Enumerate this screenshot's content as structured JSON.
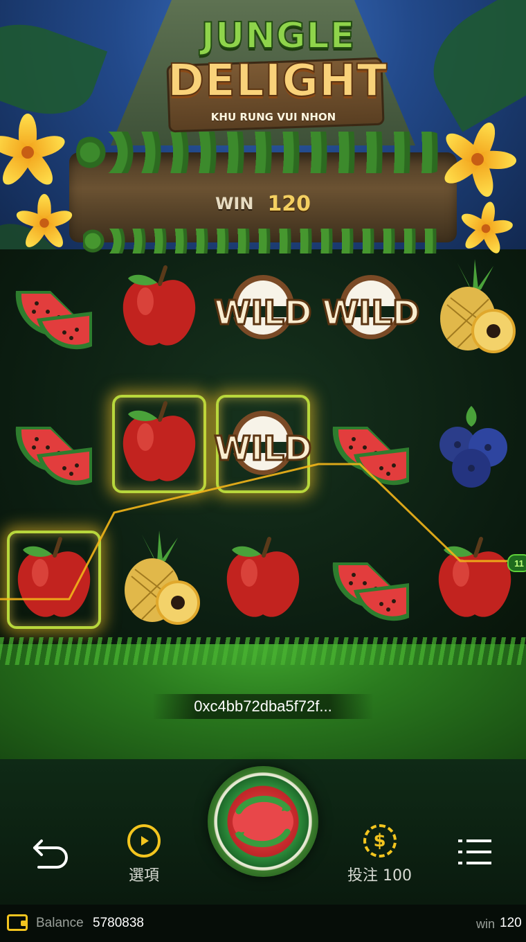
{
  "game": {
    "logo_line1": "JUNGLE",
    "logo_line2": "DELIGHT",
    "logo_subtitle": "KHU RUNG VUI NHON"
  },
  "win_banner": {
    "label": "WIN",
    "value": "120"
  },
  "reels": {
    "rows": [
      [
        "watermelon",
        "apple",
        "wild",
        "wild",
        "pineapple"
      ],
      [
        "watermelon",
        "apple",
        "wild",
        "watermelon",
        "blueberry"
      ],
      [
        "apple",
        "pineapple",
        "apple",
        "watermelon",
        "apple"
      ]
    ],
    "wild_label": "WILD",
    "highlighted": [
      [
        2,
        0
      ],
      [
        1,
        1
      ],
      [
        1,
        2
      ]
    ],
    "payline_tag": "11"
  },
  "transaction_hash": "0xc4bb72dba5f72f...",
  "controls": {
    "back_icon": "undo-arrow-icon",
    "options_label": "選項",
    "options_icon": "play-circle-icon",
    "bet_label": "投注 100",
    "bet_icon": "dollar-coin-icon",
    "menu_icon": "list-menu-icon",
    "spin_icon": "watermelon-spin-icon"
  },
  "status_bar": {
    "balance_label": "Balance",
    "balance_value": "5780838",
    "win_label": "win",
    "win_value": "120"
  },
  "colors": {
    "accent_gold": "#f3c51f",
    "win_value": "#f3cf61",
    "payline": "#f2b51a"
  }
}
